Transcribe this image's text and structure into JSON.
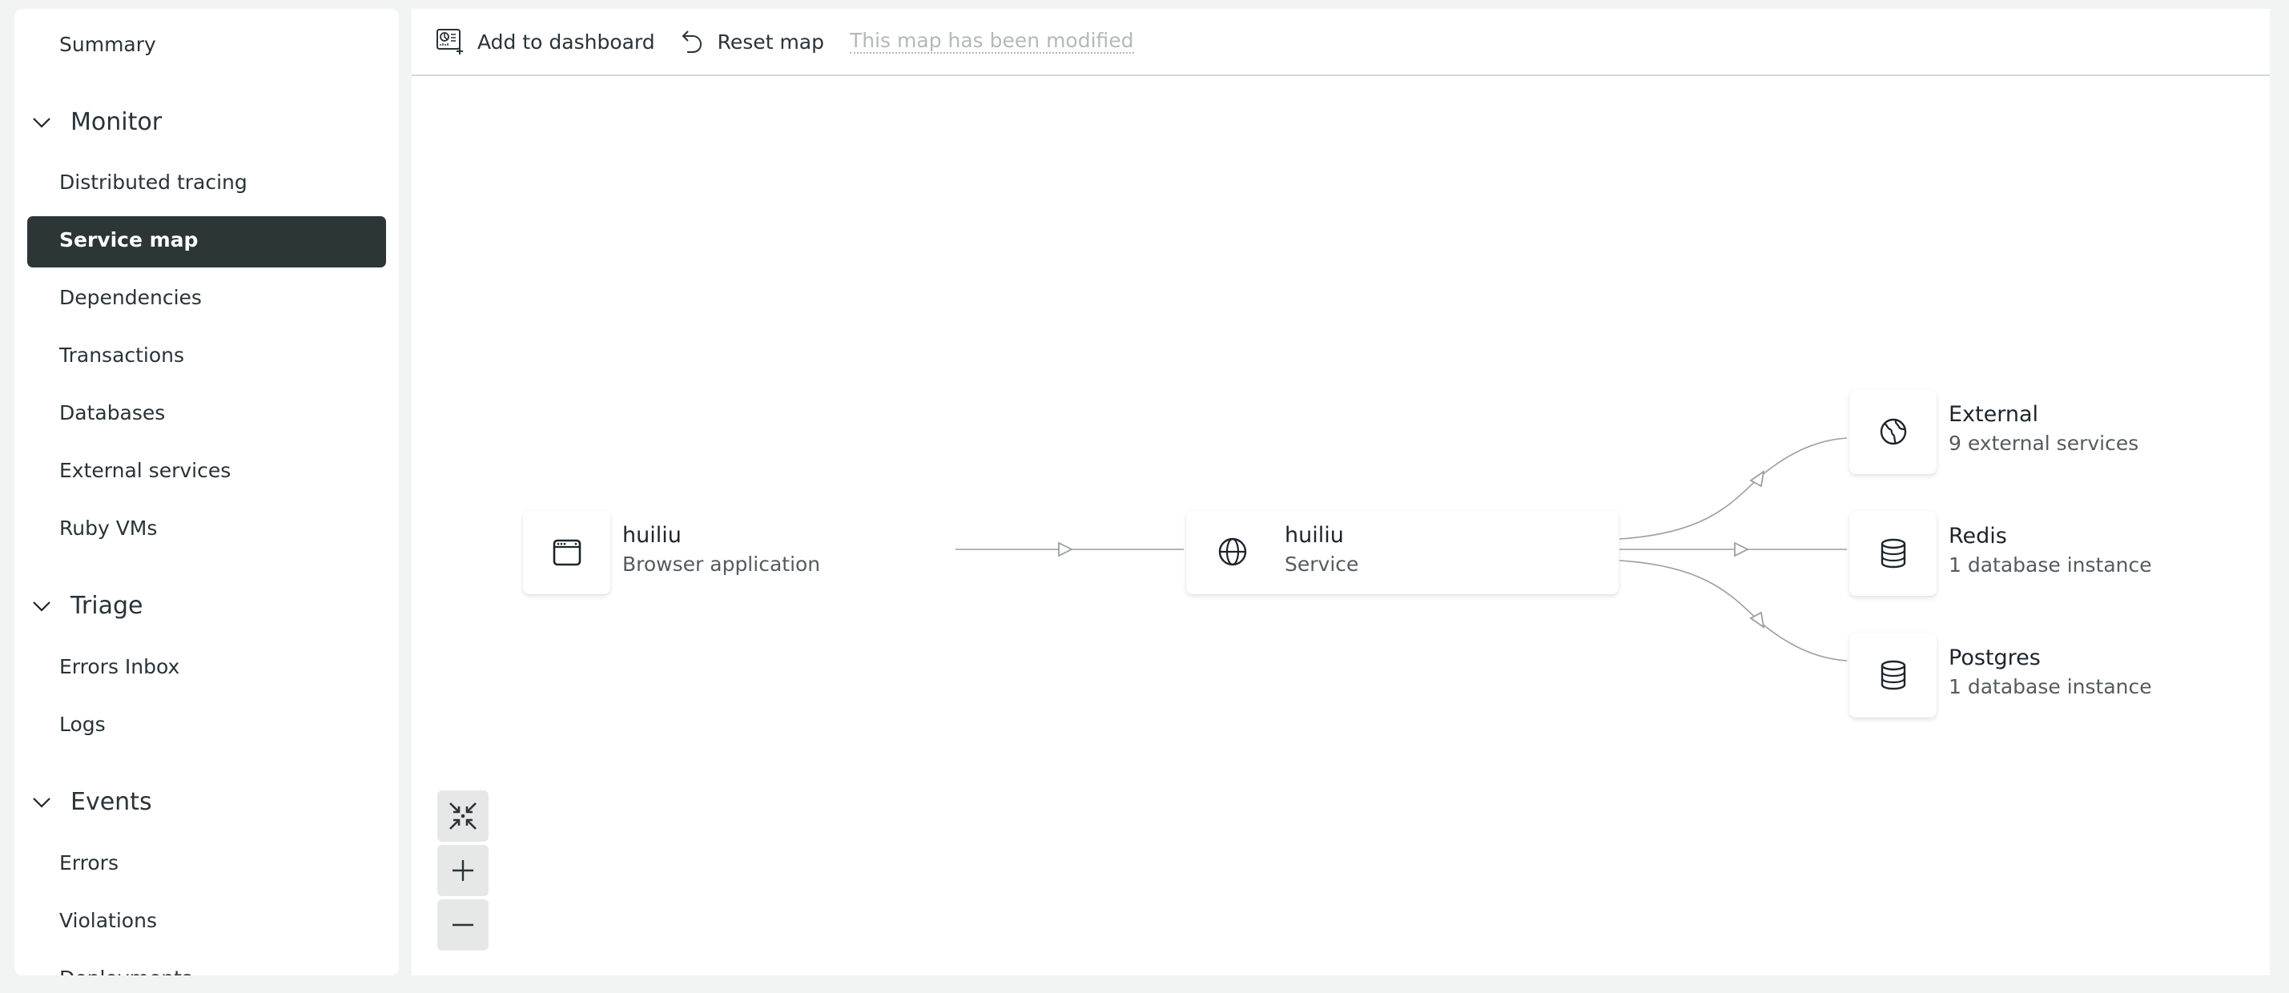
{
  "sidebar": {
    "summary": "Summary",
    "sections": [
      {
        "title": "Monitor",
        "items": [
          "Distributed tracing",
          "Service map",
          "Dependencies",
          "Transactions",
          "Databases",
          "External services",
          "Ruby VMs"
        ],
        "active": "Service map"
      },
      {
        "title": "Triage",
        "items": [
          "Errors Inbox",
          "Logs"
        ]
      },
      {
        "title": "Events",
        "items": [
          "Errors",
          "Violations",
          "Deployments"
        ]
      }
    ]
  },
  "toolbar": {
    "add_to_dashboard": "Add to dashboard",
    "reset_map": "Reset map",
    "modified_note": "This map has been modified"
  },
  "map": {
    "nodes": [
      {
        "id": "browser",
        "name": "huiliu",
        "subtitle": "Browser application",
        "icon": "browser-window-icon"
      },
      {
        "id": "service",
        "name": "huiliu",
        "subtitle": "Service",
        "icon": "globe-icon"
      },
      {
        "id": "external",
        "name": "External",
        "subtitle": "9 external services",
        "icon": "world-map-icon"
      },
      {
        "id": "redis",
        "name": "Redis",
        "subtitle": "1 database instance",
        "icon": "database-icon"
      },
      {
        "id": "postgres",
        "name": "Postgres",
        "subtitle": "1 database instance",
        "icon": "database-icon"
      }
    ],
    "edges": [
      {
        "from": "browser",
        "to": "service"
      },
      {
        "from": "service",
        "to": "external"
      },
      {
        "from": "service",
        "to": "redis"
      },
      {
        "from": "service",
        "to": "postgres"
      }
    ],
    "controls": [
      "fit-to-screen",
      "zoom-in",
      "zoom-out"
    ]
  },
  "colors": {
    "active_nav_bg": "#2d3637",
    "edge": "#9a9fa0",
    "modified_note": "#b4b8b9"
  }
}
